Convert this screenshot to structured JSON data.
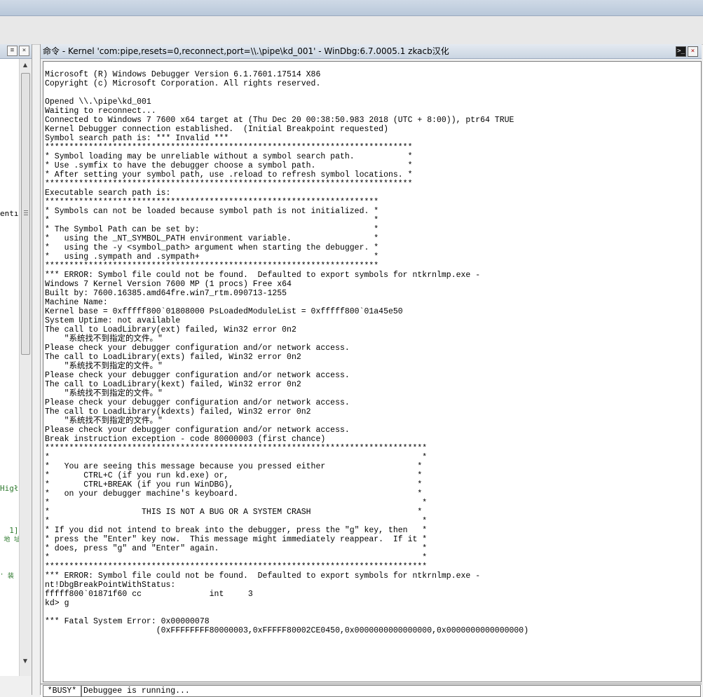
{
  "command_window": {
    "title": "命令 - Kernel 'com:pipe,resets=0,reconnect,port=\\\\.\\pipe\\kd_001' - WinDbg:6.7.0005.1 zkacb汉化",
    "output_lines": [
      "Microsoft (R) Windows Debugger Version 6.1.7601.17514 X86",
      "Copyright (c) Microsoft Corporation. All rights reserved.",
      "",
      "Opened \\\\.\\pipe\\kd_001",
      "Waiting to reconnect...",
      "Connected to Windows 7 7600 x64 target at (Thu Dec 20 00:38:50.983 2018 (UTC + 8:00)), ptr64 TRUE",
      "Kernel Debugger connection established.  (Initial Breakpoint requested)",
      "Symbol search path is: *** Invalid ***",
      "****************************************************************************",
      "* Symbol loading may be unreliable without a symbol search path.           *",
      "* Use .symfix to have the debugger choose a symbol path.                   *",
      "* After setting your symbol path, use .reload to refresh symbol locations. *",
      "****************************************************************************",
      "Executable search path is:",
      "*********************************************************************",
      "* Symbols can not be loaded because symbol path is not initialized. *",
      "*                                                                   *",
      "* The Symbol Path can be set by:                                    *",
      "*   using the _NT_SYMBOL_PATH environment variable.                 *",
      "*   using the -y <symbol_path> argument when starting the debugger. *",
      "*   using .sympath and .sympath+                                    *",
      "*********************************************************************",
      "*** ERROR: Symbol file could not be found.  Defaulted to export symbols for ntkrnlmp.exe -",
      "Windows 7 Kernel Version 7600 MP (1 procs) Free x64",
      "Built by: 7600.16385.amd64fre.win7_rtm.090713-1255",
      "Machine Name:",
      "Kernel base = 0xfffff800`01808000 PsLoadedModuleList = 0xfffff800`01a45e50",
      "System Uptime: not available",
      "The call to LoadLibrary(ext) failed, Win32 error 0n2",
      "    \"系统找不到指定的文件。\"",
      "Please check your debugger configuration and/or network access.",
      "The call to LoadLibrary(exts) failed, Win32 error 0n2",
      "    \"系统找不到指定的文件。\"",
      "Please check your debugger configuration and/or network access.",
      "The call to LoadLibrary(kext) failed, Win32 error 0n2",
      "    \"系统找不到指定的文件。\"",
      "Please check your debugger configuration and/or network access.",
      "The call to LoadLibrary(kdexts) failed, Win32 error 0n2",
      "    \"系统找不到指定的文件。\"",
      "Please check your debugger configuration and/or network access.",
      "Break instruction exception - code 80000003 (first chance)",
      "*******************************************************************************",
      "*                                                                             *",
      "*   You are seeing this message because you pressed either                   *",
      "*       CTRL+C (if you run kd.exe) or,                                       *",
      "*       CTRL+BREAK (if you run WinDBG),                                      *",
      "*   on your debugger machine's keyboard.                                     *",
      "*                                                                             *",
      "*                   THIS IS NOT A BUG OR A SYSTEM CRASH                      *",
      "*                                                                             *",
      "* If you did not intend to break into the debugger, press the \"g\" key, then   *",
      "* press the \"Enter\" key now.  This message might immediately reappear.  If it *",
      "* does, press \"g\" and \"Enter\" again.                                          *",
      "*                                                                             *",
      "*******************************************************************************",
      "*** ERROR: Symbol file could not be found.  Defaulted to export symbols for ntkrnlmp.exe -",
      "nt!DbgBreakPointWithStatus:",
      "fffff800`01871f60 cc              int     3",
      "kd> g",
      "",
      "*** Fatal System Error: 0x00000078",
      "                       (0xFFFFFFFF80000003,0xFFFFF80002CE0450,0x0000000000000000,0x0000000000000000)"
    ],
    "status_label": "*BUSY*",
    "input_value": "Debuggee is running..."
  },
  "left_pane": {
    "fragments": [
      {
        "text": "entı",
        "color": "#000000"
      },
      {
        "text": "Higł",
        "color": "#2f7a2f"
      },
      {
        "text": "  1]",
        "color": "#2f7a2f"
      },
      {
        "text": " 地 址",
        "color": "#2f7a2f"
      },
      {
        "text": "' 装",
        "color": "#2f7a2f"
      }
    ]
  }
}
